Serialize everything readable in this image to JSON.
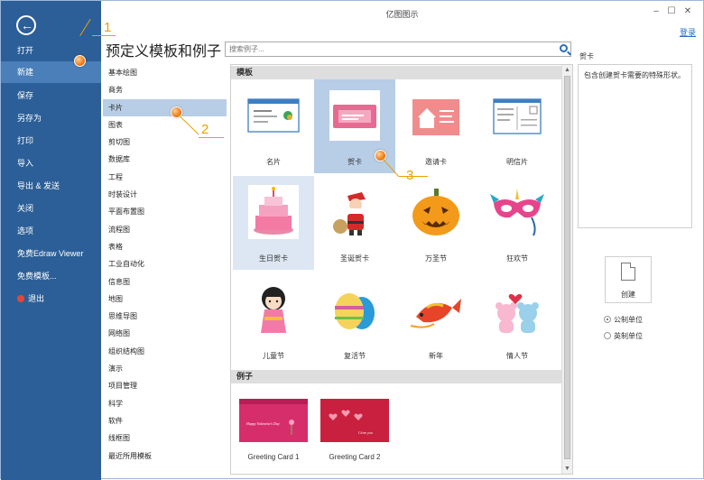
{
  "window": {
    "title": "亿图图示",
    "login": "登录",
    "minimize_icon": "–",
    "maximize_icon": "☐",
    "close_icon": "✕"
  },
  "sidebar": {
    "back_icon": "←",
    "items": [
      {
        "label": "打开"
      },
      {
        "label": "新建"
      },
      {
        "label": "保存"
      },
      {
        "label": "另存为"
      },
      {
        "label": "打印"
      },
      {
        "label": "导入"
      },
      {
        "label": "导出 & 发送"
      },
      {
        "label": "关闭"
      },
      {
        "label": "选项"
      },
      {
        "label": "免费Edraw Viewer"
      },
      {
        "label": "免费模板..."
      },
      {
        "label": "退出"
      }
    ],
    "active_index": 1
  },
  "heading": "预定义模板和例子",
  "search": {
    "placeholder": "搜索例子..."
  },
  "categories": [
    "基本绘图",
    "商务",
    "卡片",
    "图表",
    "剪切图",
    "数据库",
    "工程",
    "时装设计",
    "平面布置图",
    "流程图",
    "表格",
    "工业自动化",
    "信息图",
    "地图",
    "思维导图",
    "网络图",
    "组织结构图",
    "演示",
    "项目管理",
    "科学",
    "软件",
    "线框图",
    "最近所用模板"
  ],
  "selected_category": "卡片",
  "templates_section": "模板",
  "templates": [
    {
      "label": "名片"
    },
    {
      "label": "贺卡"
    },
    {
      "label": "邀请卡"
    },
    {
      "label": "明信片"
    },
    {
      "label": "生日贺卡"
    },
    {
      "label": "圣诞贺卡"
    },
    {
      "label": "万圣节"
    },
    {
      "label": "狂欢节"
    },
    {
      "label": "儿童节"
    },
    {
      "label": "复活节"
    },
    {
      "label": "新年"
    },
    {
      "label": "情人节"
    }
  ],
  "examples_section": "例子",
  "examples": [
    {
      "label": "Greeting Card 1",
      "inner_text": "Happy Valentine's Day"
    },
    {
      "label": "Greeting Card 2",
      "inner_text": "I love you"
    }
  ],
  "description": {
    "title": "贺卡",
    "text": "包含创建贺卡需要的特殊形状。"
  },
  "create_label": "创建",
  "units": {
    "metric": "公制单位",
    "imperial": "英制单位",
    "selected": "metric"
  },
  "callouts": [
    "1",
    "2",
    "3"
  ],
  "colors": {
    "sidebar": "#2c5f97",
    "sidebar_active": "#4a7fb9",
    "selection": "#b8cde6",
    "callout": "#e8a200",
    "link": "#2a6ebb"
  }
}
